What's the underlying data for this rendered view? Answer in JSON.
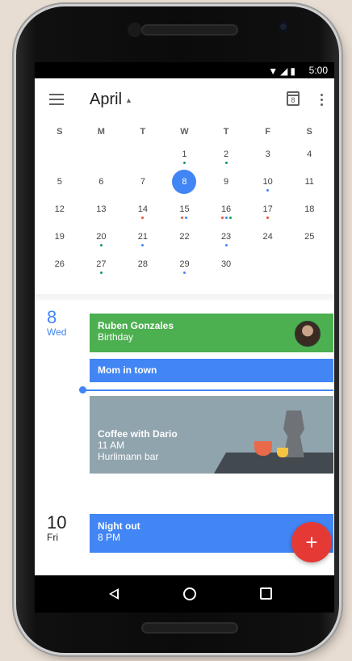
{
  "status_bar": {
    "time": "5:00"
  },
  "app_bar": {
    "month": "April",
    "today_number": "8"
  },
  "calendar": {
    "weekdays": [
      "S",
      "M",
      "T",
      "W",
      "T",
      "F",
      "S"
    ],
    "weeks": [
      [
        {
          "d": ""
        },
        {
          "d": ""
        },
        {
          "d": ""
        },
        {
          "d": "1",
          "dots": [
            "#0f9d58"
          ]
        },
        {
          "d": "2",
          "dots": [
            "#0f9d58"
          ]
        },
        {
          "d": "3"
        },
        {
          "d": "4"
        }
      ],
      [
        {
          "d": "5"
        },
        {
          "d": "6"
        },
        {
          "d": "7"
        },
        {
          "d": "8",
          "today": true
        },
        {
          "d": "9"
        },
        {
          "d": "10",
          "dots": [
            "#4285f4"
          ]
        },
        {
          "d": "11"
        }
      ],
      [
        {
          "d": "12"
        },
        {
          "d": "13"
        },
        {
          "d": "14",
          "dots": [
            "#e8542f"
          ]
        },
        {
          "d": "15",
          "dots": [
            "#e8542f",
            "#4285f4"
          ]
        },
        {
          "d": "16",
          "dots": [
            "#e8542f",
            "#4285f4",
            "#0f9d58"
          ]
        },
        {
          "d": "17",
          "dots": [
            "#e8542f"
          ]
        },
        {
          "d": "18"
        }
      ],
      [
        {
          "d": "19"
        },
        {
          "d": "20",
          "dots": [
            "#0f9d58"
          ]
        },
        {
          "d": "21",
          "dots": [
            "#4285f4"
          ]
        },
        {
          "d": "22"
        },
        {
          "d": "23",
          "dots": [
            "#4285f4"
          ]
        },
        {
          "d": "24"
        },
        {
          "d": "25"
        }
      ],
      [
        {
          "d": "26"
        },
        {
          "d": "27",
          "dots": [
            "#0f9d58"
          ]
        },
        {
          "d": "28"
        },
        {
          "d": "29",
          "dots": [
            "#4285f4"
          ]
        },
        {
          "d": "30"
        },
        {
          "d": ""
        },
        {
          "d": ""
        }
      ]
    ]
  },
  "schedule": {
    "day1": {
      "number": "8",
      "dow": "Wed"
    },
    "day2": {
      "number": "10",
      "dow": "Fri"
    },
    "events": {
      "birthday": {
        "title": "Ruben Gonzales",
        "sub": "Birthday",
        "color": "#4caf50"
      },
      "mom": {
        "title": "Mom in town",
        "color": "#4285f4"
      },
      "coffee": {
        "title": "Coffee with Dario",
        "time": "11 AM",
        "place": "Hurlimann bar"
      },
      "night": {
        "title": "Night out",
        "time": "8 PM",
        "color": "#4285f4"
      }
    }
  },
  "fab": {
    "label": "+"
  },
  "colors": {
    "accent": "#4285f4",
    "fab": "#e53935"
  }
}
